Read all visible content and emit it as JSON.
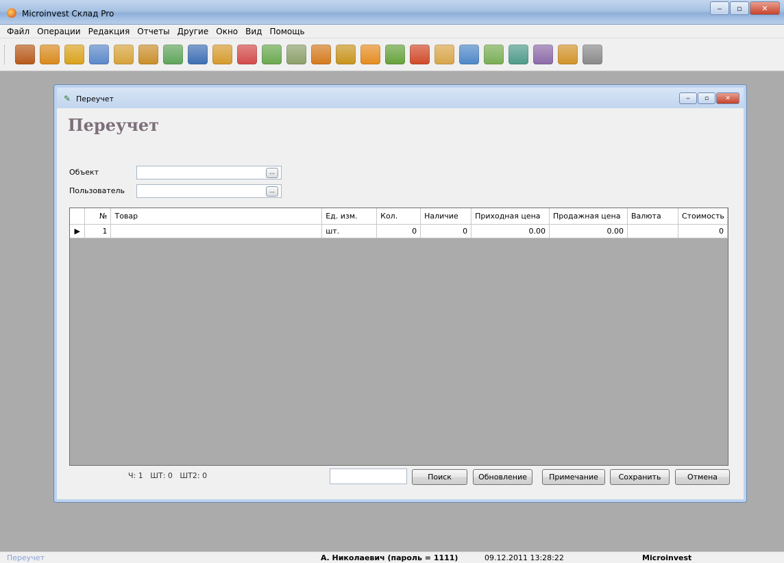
{
  "window": {
    "title": "Microinvest Склад Pro",
    "min": "‒",
    "max": "▫",
    "close": "✕"
  },
  "menu": [
    "Файл",
    "Операции",
    "Редакция",
    "Отчеты",
    "Другие",
    "Окно",
    "Вид",
    "Помощь"
  ],
  "toolbar": [
    {
      "icon": "exit-door-icon",
      "color": "#b85a1a"
    },
    {
      "icon": "box-out-icon",
      "color": "#d98a1c"
    },
    {
      "icon": "box-in-icon",
      "color": "#d9a21c"
    },
    {
      "icon": "production-star-icon",
      "color": "#5b88c9"
    },
    {
      "icon": "clipboard-icon",
      "color": "#d6a33a"
    },
    {
      "icon": "book-icon",
      "color": "#c98f2a"
    },
    {
      "icon": "envelope-icon",
      "color": "#5fa45a"
    },
    {
      "icon": "user-icon",
      "color": "#3d6fb3"
    },
    {
      "icon": "package-icon",
      "color": "#d69a2d"
    },
    {
      "icon": "keys-icon",
      "color": "#d24a4a"
    },
    {
      "icon": "refresh-doc-icon",
      "color": "#6aa84f"
    },
    {
      "icon": "scroll-icon",
      "color": "#8ba06a"
    },
    {
      "icon": "doc-box-icon",
      "color": "#d47a1e"
    },
    {
      "icon": "calendar-icon",
      "color": "#c8941e"
    },
    {
      "icon": "doc-orange-icon",
      "color": "#e58c1f"
    },
    {
      "icon": "doc-green-icon",
      "color": "#66a23c"
    },
    {
      "icon": "doc-red-icon",
      "color": "#d04a2a"
    },
    {
      "icon": "doc-stack-icon",
      "color": "#d8a64a"
    },
    {
      "icon": "doc-edit-icon",
      "color": "#4e87c8"
    },
    {
      "icon": "doc-check-icon",
      "color": "#79ad55"
    },
    {
      "icon": "doc-mail-icon",
      "color": "#4f9b8a"
    },
    {
      "icon": "report-icon",
      "color": "#8c6aa8"
    },
    {
      "icon": "user-doc-icon",
      "color": "#d2932a"
    },
    {
      "icon": "settings-gear-icon",
      "color": "#8a8a8a"
    }
  ],
  "child": {
    "title": "Переучет",
    "heading": "Переучет",
    "object_label": "Объект",
    "user_label": "Пользователь",
    "object_value": "",
    "user_value": "",
    "browse": "..."
  },
  "table": {
    "columns": [
      "№",
      "Товар",
      "Ед. изм.",
      "Кол.",
      "Наличие",
      "Приходная цена",
      "Продажная цена",
      "Валюта",
      "Стоимость"
    ],
    "rows": [
      {
        "marker": "▶",
        "num": "1",
        "item": "",
        "unit": "шт.",
        "qty": "0",
        "avail": "0",
        "purchase": "0.00",
        "sale": "0.00",
        "currency": "",
        "cost": "0"
      }
    ]
  },
  "footer": {
    "info": "Ч: 1   ШТ: 0   ШТ2: 0",
    "search_value": "",
    "buttons": {
      "search": "Поиск",
      "refresh": "Обновление",
      "note": "Примечание",
      "save": "Сохранить",
      "cancel": "Отмена"
    }
  },
  "status": {
    "module": "Переучет",
    "user": "А. Николаевич (пароль = 1111)",
    "datetime": "09.12.2011 13:28:22",
    "company": "Microinvest"
  }
}
